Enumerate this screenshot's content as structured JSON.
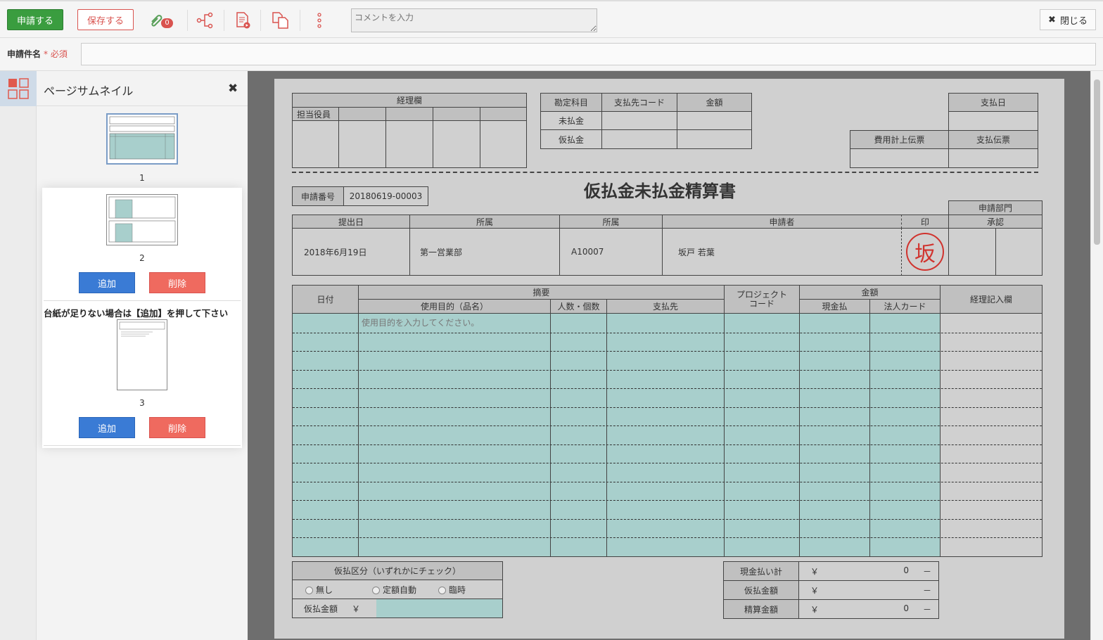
{
  "toolbar": {
    "apply_label": "申請する",
    "save_label": "保存する",
    "attachment_count": "0",
    "comment_placeholder": "コメントを入力",
    "close_label": "閉じる"
  },
  "title_field": {
    "label": "申請件名",
    "required_mark": "* 必須",
    "value": ""
  },
  "side_panel": {
    "title": "ページサムネイル",
    "pages": [
      {
        "number": "1"
      },
      {
        "number": "2",
        "add_label": "追加",
        "delete_label": "削除"
      },
      {
        "number": "3",
        "add_label": "追加",
        "delete_label": "削除"
      }
    ],
    "notice": "台紙が足りない場合は【追加】を押して下さい"
  },
  "form": {
    "title": "仮払金未払金精算書",
    "accounting": {
      "header": "経理欄",
      "officer": "担当役員"
    },
    "account_table": {
      "headers": [
        "勘定科目",
        "支払先コード",
        "金額"
      ],
      "rows": [
        "未払金",
        "仮払金"
      ]
    },
    "payment": {
      "payment_date": "支払日",
      "expense_voucher": "費用計上伝票",
      "payment_voucher": "支払伝票"
    },
    "application_number": {
      "label": "申請番号",
      "value": "20180619-00003"
    },
    "info": {
      "headers": [
        "提出日",
        "所属",
        "所属",
        "申請者",
        "印"
      ],
      "values": [
        "2018年6月19日",
        "第一営業部",
        "A10007",
        "坂戸 若葉"
      ],
      "dept_header": "申請部門",
      "approval": "承認",
      "stamp_char": "坂"
    },
    "details": {
      "date": "日付",
      "summary": "摘要",
      "purpose": "使用目的（品名）",
      "count": "人数・個数",
      "payee": "支払先",
      "project": "プロジェクト",
      "project2": "コード",
      "amount": "金額",
      "cash": "現金払",
      "card": "法人カード",
      "accounting_entry": "経理記入欄",
      "purpose_placeholder": "使用目的を入力してください。",
      "row_count": 13
    },
    "advance": {
      "header": "仮払区分（いずれかにチェック）",
      "options": [
        "無し",
        "定額自動",
        "臨時"
      ],
      "amount_label": "仮払金額",
      "yen": "￥"
    },
    "totals": [
      {
        "label": "現金払い計",
        "yen": "￥",
        "value": "0",
        "dash": "－"
      },
      {
        "label": "仮払金額",
        "yen": "￥",
        "value": "",
        "dash": "－"
      },
      {
        "label": "精算金額",
        "yen": "￥",
        "value": "0",
        "dash": "－"
      }
    ]
  },
  "colors": {
    "apply": "#3a9d3f",
    "danger": "#d9534f",
    "add": "#3a7bd5",
    "delete": "#ef6a5f",
    "input_fill": "#a8cfcc"
  }
}
